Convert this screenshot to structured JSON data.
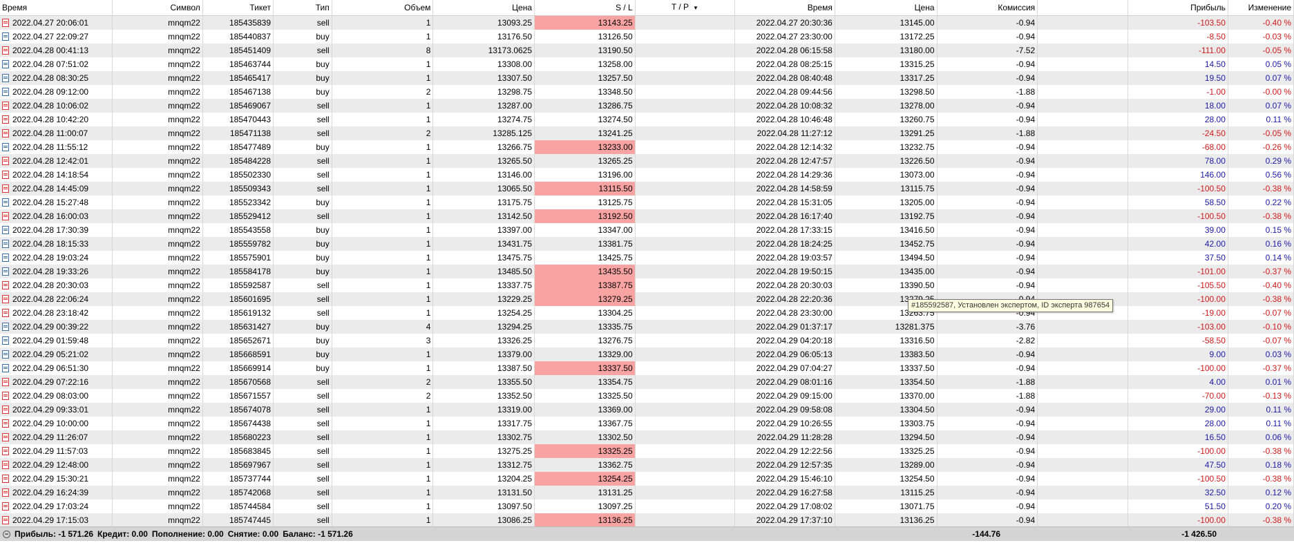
{
  "headers": {
    "time": "Время",
    "symbol": "Символ",
    "ticket": "Тикет",
    "type": "Тип",
    "volume": "Объем",
    "price": "Цена",
    "sl": "S / L",
    "tp": "T / P",
    "close_time": "Время",
    "close_price": "Цена",
    "commission": "Комиссия",
    "swap": "",
    "profit": "Прибыль",
    "change": "Изменение"
  },
  "sort_icon": "triangle-down-icon",
  "rows": [
    {
      "time": "2022.04.27 20:06:01",
      "symbol": "mnqm22",
      "ticket": "185435839",
      "type": "sell",
      "volume": "1",
      "price": "13093.25",
      "sl": "13143.25",
      "sl_hit": true,
      "tp": "",
      "close_time": "2022.04.27 20:30:36",
      "close_price": "13145.00",
      "commission": "-0.94",
      "profit": "-103.50",
      "change": "-0.40 %",
      "neg": true
    },
    {
      "time": "2022.04.27 22:09:27",
      "symbol": "mnqm22",
      "ticket": "185440837",
      "type": "buy",
      "volume": "1",
      "price": "13176.50",
      "sl": "13126.50",
      "sl_hit": false,
      "tp": "",
      "close_time": "2022.04.27 23:30:00",
      "close_price": "13172.25",
      "commission": "-0.94",
      "profit": "-8.50",
      "change": "-0.03 %",
      "neg": true
    },
    {
      "time": "2022.04.28 00:41:13",
      "symbol": "mnqm22",
      "ticket": "185451409",
      "type": "sell",
      "volume": "8",
      "price": "13173.0625",
      "sl": "13190.50",
      "sl_hit": false,
      "tp": "",
      "close_time": "2022.04.28 06:15:58",
      "close_price": "13180.00",
      "commission": "-7.52",
      "profit": "-111.00",
      "change": "-0.05 %",
      "neg": true
    },
    {
      "time": "2022.04.28 07:51:02",
      "symbol": "mnqm22",
      "ticket": "185463744",
      "type": "buy",
      "volume": "1",
      "price": "13308.00",
      "sl": "13258.00",
      "sl_hit": false,
      "tp": "",
      "close_time": "2022.04.28 08:25:15",
      "close_price": "13315.25",
      "commission": "-0.94",
      "profit": "14.50",
      "change": "0.05 %",
      "neg": false
    },
    {
      "time": "2022.04.28 08:30:25",
      "symbol": "mnqm22",
      "ticket": "185465417",
      "type": "buy",
      "volume": "1",
      "price": "13307.50",
      "sl": "13257.50",
      "sl_hit": false,
      "tp": "",
      "close_time": "2022.04.28 08:40:48",
      "close_price": "13317.25",
      "commission": "-0.94",
      "profit": "19.50",
      "change": "0.07 %",
      "neg": false
    },
    {
      "time": "2022.04.28 09:12:00",
      "symbol": "mnqm22",
      "ticket": "185467138",
      "type": "buy",
      "volume": "2",
      "price": "13298.75",
      "sl": "13348.50",
      "sl_hit": false,
      "tp": "",
      "close_time": "2022.04.28 09:44:56",
      "close_price": "13298.50",
      "commission": "-1.88",
      "profit": "-1.00",
      "change": "-0.00 %",
      "neg": true
    },
    {
      "time": "2022.04.28 10:06:02",
      "symbol": "mnqm22",
      "ticket": "185469067",
      "type": "sell",
      "volume": "1",
      "price": "13287.00",
      "sl": "13286.75",
      "sl_hit": false,
      "tp": "",
      "close_time": "2022.04.28 10:08:32",
      "close_price": "13278.00",
      "commission": "-0.94",
      "profit": "18.00",
      "change": "0.07 %",
      "neg": false
    },
    {
      "time": "2022.04.28 10:42:20",
      "symbol": "mnqm22",
      "ticket": "185470443",
      "type": "sell",
      "volume": "1",
      "price": "13274.75",
      "sl": "13274.50",
      "sl_hit": false,
      "tp": "",
      "close_time": "2022.04.28 10:46:48",
      "close_price": "13260.75",
      "commission": "-0.94",
      "profit": "28.00",
      "change": "0.11 %",
      "neg": false
    },
    {
      "time": "2022.04.28 11:00:07",
      "symbol": "mnqm22",
      "ticket": "185471138",
      "type": "sell",
      "volume": "2",
      "price": "13285.125",
      "sl": "13241.25",
      "sl_hit": false,
      "tp": "",
      "close_time": "2022.04.28 11:27:12",
      "close_price": "13291.25",
      "commission": "-1.88",
      "profit": "-24.50",
      "change": "-0.05 %",
      "neg": true
    },
    {
      "time": "2022.04.28 11:55:12",
      "symbol": "mnqm22",
      "ticket": "185477489",
      "type": "buy",
      "volume": "1",
      "price": "13266.75",
      "sl": "13233.00",
      "sl_hit": true,
      "tp": "",
      "close_time": "2022.04.28 12:14:32",
      "close_price": "13232.75",
      "commission": "-0.94",
      "profit": "-68.00",
      "change": "-0.26 %",
      "neg": true
    },
    {
      "time": "2022.04.28 12:42:01",
      "symbol": "mnqm22",
      "ticket": "185484228",
      "type": "sell",
      "volume": "1",
      "price": "13265.50",
      "sl": "13265.25",
      "sl_hit": false,
      "tp": "",
      "close_time": "2022.04.28 12:47:57",
      "close_price": "13226.50",
      "commission": "-0.94",
      "profit": "78.00",
      "change": "0.29 %",
      "neg": false
    },
    {
      "time": "2022.04.28 14:18:54",
      "symbol": "mnqm22",
      "ticket": "185502330",
      "type": "sell",
      "volume": "1",
      "price": "13146.00",
      "sl": "13196.00",
      "sl_hit": false,
      "tp": "",
      "close_time": "2022.04.28 14:29:36",
      "close_price": "13073.00",
      "commission": "-0.94",
      "profit": "146.00",
      "change": "0.56 %",
      "neg": false
    },
    {
      "time": "2022.04.28 14:45:09",
      "symbol": "mnqm22",
      "ticket": "185509343",
      "type": "sell",
      "volume": "1",
      "price": "13065.50",
      "sl": "13115.50",
      "sl_hit": true,
      "tp": "",
      "close_time": "2022.04.28 14:58:59",
      "close_price": "13115.75",
      "commission": "-0.94",
      "profit": "-100.50",
      "change": "-0.38 %",
      "neg": true
    },
    {
      "time": "2022.04.28 15:27:48",
      "symbol": "mnqm22",
      "ticket": "185523342",
      "type": "buy",
      "volume": "1",
      "price": "13175.75",
      "sl": "13125.75",
      "sl_hit": false,
      "tp": "",
      "close_time": "2022.04.28 15:31:05",
      "close_price": "13205.00",
      "commission": "-0.94",
      "profit": "58.50",
      "change": "0.22 %",
      "neg": false
    },
    {
      "time": "2022.04.28 16:00:03",
      "symbol": "mnqm22",
      "ticket": "185529412",
      "type": "sell",
      "volume": "1",
      "price": "13142.50",
      "sl": "13192.50",
      "sl_hit": true,
      "tp": "",
      "close_time": "2022.04.28 16:17:40",
      "close_price": "13192.75",
      "commission": "-0.94",
      "profit": "-100.50",
      "change": "-0.38 %",
      "neg": true
    },
    {
      "time": "2022.04.28 17:30:39",
      "symbol": "mnqm22",
      "ticket": "185543558",
      "type": "buy",
      "volume": "1",
      "price": "13397.00",
      "sl": "13347.00",
      "sl_hit": false,
      "tp": "",
      "close_time": "2022.04.28 17:33:15",
      "close_price": "13416.50",
      "commission": "-0.94",
      "profit": "39.00",
      "change": "0.15 %",
      "neg": false
    },
    {
      "time": "2022.04.28 18:15:33",
      "symbol": "mnqm22",
      "ticket": "185559782",
      "type": "buy",
      "volume": "1",
      "price": "13431.75",
      "sl": "13381.75",
      "sl_hit": false,
      "tp": "",
      "close_time": "2022.04.28 18:24:25",
      "close_price": "13452.75",
      "commission": "-0.94",
      "profit": "42.00",
      "change": "0.16 %",
      "neg": false
    },
    {
      "time": "2022.04.28 19:03:24",
      "symbol": "mnqm22",
      "ticket": "185575901",
      "type": "buy",
      "volume": "1",
      "price": "13475.75",
      "sl": "13425.75",
      "sl_hit": false,
      "tp": "",
      "close_time": "2022.04.28 19:03:57",
      "close_price": "13494.50",
      "commission": "-0.94",
      "profit": "37.50",
      "change": "0.14 %",
      "neg": false
    },
    {
      "time": "2022.04.28 19:33:26",
      "symbol": "mnqm22",
      "ticket": "185584178",
      "type": "buy",
      "volume": "1",
      "price": "13485.50",
      "sl": "13435.50",
      "sl_hit": true,
      "tp": "",
      "close_time": "2022.04.28 19:50:15",
      "close_price": "13435.00",
      "commission": "-0.94",
      "profit": "-101.00",
      "change": "-0.37 %",
      "neg": true
    },
    {
      "time": "2022.04.28 20:30:03",
      "symbol": "mnqm22",
      "ticket": "185592587",
      "type": "sell",
      "volume": "1",
      "price": "13337.75",
      "sl": "13387.75",
      "sl_hit": true,
      "tp": "",
      "close_time": "2022.04.28 20:30:03",
      "close_price": "13390.50",
      "commission": "-0.94",
      "profit": "-105.50",
      "change": "-0.40 %",
      "neg": true
    },
    {
      "time": "2022.04.28 22:06:24",
      "symbol": "mnqm22",
      "ticket": "185601695",
      "type": "sell",
      "volume": "1",
      "price": "13229.25",
      "sl": "13279.25",
      "sl_hit": true,
      "tp": "",
      "close_time": "2022.04.28 22:20:36",
      "close_price": "13279.25",
      "commission": "-0.94",
      "profit": "-100.00",
      "change": "-0.38 %",
      "neg": true
    },
    {
      "time": "2022.04.28 23:18:42",
      "symbol": "mnqm22",
      "ticket": "185619132",
      "type": "sell",
      "volume": "1",
      "price": "13254.25",
      "sl": "13304.25",
      "sl_hit": false,
      "tp": "",
      "close_time": "2022.04.28 23:30:00",
      "close_price": "13263.75",
      "commission": "-0.94",
      "profit": "-19.00",
      "change": "-0.07 %",
      "neg": true
    },
    {
      "time": "2022.04.29 00:39:22",
      "symbol": "mnqm22",
      "ticket": "185631427",
      "type": "buy",
      "volume": "4",
      "price": "13294.25",
      "sl": "13335.75",
      "sl_hit": false,
      "tp": "",
      "close_time": "2022.04.29 01:37:17",
      "close_price": "13281.375",
      "commission": "-3.76",
      "profit": "-103.00",
      "change": "-0.10 %",
      "neg": true
    },
    {
      "time": "2022.04.29 01:59:48",
      "symbol": "mnqm22",
      "ticket": "185652671",
      "type": "buy",
      "volume": "3",
      "price": "13326.25",
      "sl": "13276.75",
      "sl_hit": false,
      "tp": "",
      "close_time": "2022.04.29 04:20:18",
      "close_price": "13316.50",
      "commission": "-2.82",
      "profit": "-58.50",
      "change": "-0.07 %",
      "neg": true
    },
    {
      "time": "2022.04.29 05:21:02",
      "symbol": "mnqm22",
      "ticket": "185668591",
      "type": "buy",
      "volume": "1",
      "price": "13379.00",
      "sl": "13329.00",
      "sl_hit": false,
      "tp": "",
      "close_time": "2022.04.29 06:05:13",
      "close_price": "13383.50",
      "commission": "-0.94",
      "profit": "9.00",
      "change": "0.03 %",
      "neg": false
    },
    {
      "time": "2022.04.29 06:51:30",
      "symbol": "mnqm22",
      "ticket": "185669914",
      "type": "buy",
      "volume": "1",
      "price": "13387.50",
      "sl": "13337.50",
      "sl_hit": true,
      "tp": "",
      "close_time": "2022.04.29 07:04:27",
      "close_price": "13337.50",
      "commission": "-0.94",
      "profit": "-100.00",
      "change": "-0.37 %",
      "neg": true
    },
    {
      "time": "2022.04.29 07:22:16",
      "symbol": "mnqm22",
      "ticket": "185670568",
      "type": "sell",
      "volume": "2",
      "price": "13355.50",
      "sl": "13354.75",
      "sl_hit": false,
      "tp": "",
      "close_time": "2022.04.29 08:01:16",
      "close_price": "13354.50",
      "commission": "-1.88",
      "profit": "4.00",
      "change": "0.01 %",
      "neg": false
    },
    {
      "time": "2022.04.29 08:03:00",
      "symbol": "mnqm22",
      "ticket": "185671557",
      "type": "sell",
      "volume": "2",
      "price": "13352.50",
      "sl": "13325.50",
      "sl_hit": false,
      "tp": "",
      "close_time": "2022.04.29 09:15:00",
      "close_price": "13370.00",
      "commission": "-1.88",
      "profit": "-70.00",
      "change": "-0.13 %",
      "neg": true
    },
    {
      "time": "2022.04.29 09:33:01",
      "symbol": "mnqm22",
      "ticket": "185674078",
      "type": "sell",
      "volume": "1",
      "price": "13319.00",
      "sl": "13369.00",
      "sl_hit": false,
      "tp": "",
      "close_time": "2022.04.29 09:58:08",
      "close_price": "13304.50",
      "commission": "-0.94",
      "profit": "29.00",
      "change": "0.11 %",
      "neg": false
    },
    {
      "time": "2022.04.29 10:00:00",
      "symbol": "mnqm22",
      "ticket": "185674438",
      "type": "sell",
      "volume": "1",
      "price": "13317.75",
      "sl": "13367.75",
      "sl_hit": false,
      "tp": "",
      "close_time": "2022.04.29 10:26:55",
      "close_price": "13303.75",
      "commission": "-0.94",
      "profit": "28.00",
      "change": "0.11 %",
      "neg": false
    },
    {
      "time": "2022.04.29 11:26:07",
      "symbol": "mnqm22",
      "ticket": "185680223",
      "type": "sell",
      "volume": "1",
      "price": "13302.75",
      "sl": "13302.50",
      "sl_hit": false,
      "tp": "",
      "close_time": "2022.04.29 11:28:28",
      "close_price": "13294.50",
      "commission": "-0.94",
      "profit": "16.50",
      "change": "0.06 %",
      "neg": false
    },
    {
      "time": "2022.04.29 11:57:03",
      "symbol": "mnqm22",
      "ticket": "185683845",
      "type": "sell",
      "volume": "1",
      "price": "13275.25",
      "sl": "13325.25",
      "sl_hit": true,
      "tp": "",
      "close_time": "2022.04.29 12:22:56",
      "close_price": "13325.25",
      "commission": "-0.94",
      "profit": "-100.00",
      "change": "-0.38 %",
      "neg": true
    },
    {
      "time": "2022.04.29 12:48:00",
      "symbol": "mnqm22",
      "ticket": "185697967",
      "type": "sell",
      "volume": "1",
      "price": "13312.75",
      "sl": "13362.75",
      "sl_hit": false,
      "tp": "",
      "close_time": "2022.04.29 12:57:35",
      "close_price": "13289.00",
      "commission": "-0.94",
      "profit": "47.50",
      "change": "0.18 %",
      "neg": false
    },
    {
      "time": "2022.04.29 15:30:21",
      "symbol": "mnqm22",
      "ticket": "185737744",
      "type": "sell",
      "volume": "1",
      "price": "13204.25",
      "sl": "13254.25",
      "sl_hit": true,
      "tp": "",
      "close_time": "2022.04.29 15:46:10",
      "close_price": "13254.50",
      "commission": "-0.94",
      "profit": "-100.50",
      "change": "-0.38 %",
      "neg": true
    },
    {
      "time": "2022.04.29 16:24:39",
      "symbol": "mnqm22",
      "ticket": "185742068",
      "type": "sell",
      "volume": "1",
      "price": "13131.50",
      "sl": "13131.25",
      "sl_hit": false,
      "tp": "",
      "close_time": "2022.04.29 16:27:58",
      "close_price": "13115.25",
      "commission": "-0.94",
      "profit": "32.50",
      "change": "0.12 %",
      "neg": false
    },
    {
      "time": "2022.04.29 17:03:24",
      "symbol": "mnqm22",
      "ticket": "185744584",
      "type": "sell",
      "volume": "1",
      "price": "13097.50",
      "sl": "13097.25",
      "sl_hit": false,
      "tp": "",
      "close_time": "2022.04.29 17:08:02",
      "close_price": "13071.75",
      "commission": "-0.94",
      "profit": "51.50",
      "change": "0.20 %",
      "neg": false
    },
    {
      "time": "2022.04.29 17:15:03",
      "symbol": "mnqm22",
      "ticket": "185747445",
      "type": "sell",
      "volume": "1",
      "price": "13086.25",
      "sl": "13136.25",
      "sl_hit": true,
      "tp": "",
      "close_time": "2022.04.29 17:37:10",
      "close_price": "13136.25",
      "commission": "-0.94",
      "profit": "-100.00",
      "change": "-0.38 %",
      "neg": true
    }
  ],
  "footer": {
    "collapse_icon": "minus-circle-icon",
    "profit": "Прибыль: -1 571.26",
    "credit": "Кредит: 0.00",
    "deposit": "Пополнение: 0.00",
    "withdrawal": "Снятие: 0.00",
    "balance": "Баланс: -1 571.26",
    "commission_total": "-144.76",
    "profit_total": "-1 426.50"
  },
  "tooltip": "#185592587, Установлен экспертом, ID эксперта 987654",
  "colors": {
    "sl_hit": "#f9a3a3",
    "negative": "#d11919",
    "positive": "#1a1aa8",
    "even_row": "#ebebeb"
  }
}
